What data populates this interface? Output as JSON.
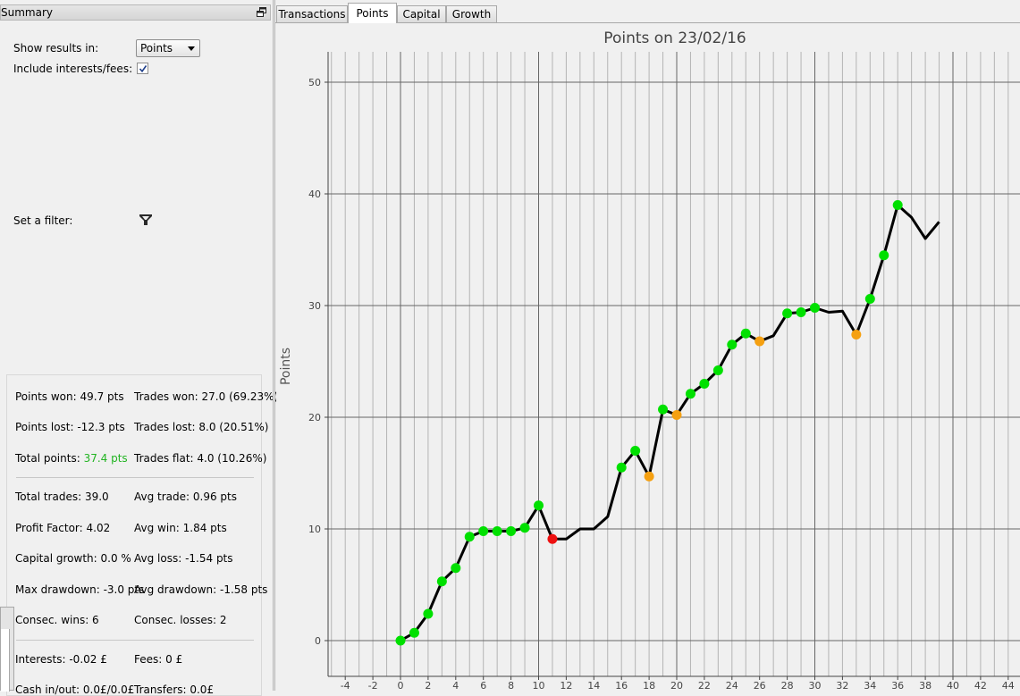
{
  "summary": {
    "title": "Summary",
    "show_results_label": "Show results in:",
    "show_results_value": "Points",
    "include_label": "Include interests/fees:",
    "include_checked": true,
    "filter_label": "Set a filter:"
  },
  "stats": {
    "points_won": "Points won: 49.7 pts",
    "trades_won": "Trades won: 27.0 (69.23%)",
    "points_lost": "Points lost: -12.3 pts",
    "trades_lost": "Trades lost: 8.0 (20.51%)",
    "total_points_label": "Total points:",
    "total_points_value": "37.4 pts",
    "trades_flat": "Trades flat: 4.0 (10.26%)",
    "total_trades": "Total trades: 39.0",
    "avg_trade": "Avg trade: 0.96 pts",
    "profit_factor": "Profit Factor: 4.02",
    "avg_win": "Avg win: 1.84 pts",
    "capital_growth": "Capital growth: 0.0 %",
    "avg_loss": "Avg loss: -1.54 pts",
    "max_drawdown": "Max drawdown: -3.0 pts",
    "avg_drawdown": "Avg drawdown: -1.58 pts",
    "consec_wins": "Consec. wins: 6",
    "consec_losses": "Consec. losses: 2",
    "interests": "Interests: -0.02 £",
    "fees": "Fees: 0 £",
    "cash_in_out": "Cash in/out: 0.0£/0.0£",
    "transfers": "Transfers: 0.0£"
  },
  "tabs": [
    {
      "label": "Transactions",
      "active": false
    },
    {
      "label": "Points",
      "active": true
    },
    {
      "label": "Capital",
      "active": false
    },
    {
      "label": "Growth",
      "active": false
    }
  ],
  "colors": {
    "win": "#00e000",
    "loss": "#ee1111",
    "flat": "#f5a011",
    "line": "#000000",
    "total_points_accent": "#22b422"
  },
  "icons": {
    "float": "float-window-icon",
    "filter": "funnel-icon",
    "checkbox": "checkmark-icon"
  },
  "chart_data": {
    "type": "line",
    "title": "Points on 23/02/16",
    "xlabel": "",
    "ylabel": "Points",
    "xlim": [
      -5,
      45
    ],
    "ylim": [
      -3,
      53
    ],
    "x_ticks": [
      -4,
      -2,
      0,
      2,
      4,
      6,
      8,
      10,
      12,
      14,
      16,
      18,
      20,
      22,
      24,
      26,
      28,
      30,
      32,
      34,
      36,
      38,
      40,
      42,
      44
    ],
    "y_ticks": [
      0,
      10,
      20,
      30,
      40,
      50
    ],
    "grid": true,
    "line": {
      "x": [
        0,
        1,
        2,
        3,
        4,
        5,
        6,
        7,
        8,
        9,
        10,
        11,
        12,
        13,
        14,
        15,
        16,
        17,
        18,
        19,
        20,
        21,
        22,
        23,
        24,
        25,
        26,
        27,
        28,
        29,
        30,
        31,
        32,
        33,
        34,
        35,
        36,
        37,
        38,
        39
      ],
      "y": [
        0,
        0.7,
        2.4,
        5.3,
        6.5,
        9.3,
        9.8,
        9.8,
        9.8,
        10.1,
        12.1,
        9.1,
        9.1,
        10.0,
        10.0,
        11.1,
        15.5,
        17.0,
        14.7,
        20.7,
        20.2,
        22.1,
        23.0,
        24.2,
        26.5,
        27.5,
        26.8,
        27.3,
        29.3,
        29.4,
        29.8,
        29.4,
        29.5,
        27.4,
        30.6,
        34.5,
        39.0,
        37.9,
        36.0,
        37.5
      ]
    },
    "points": [
      {
        "x": 0,
        "y": 0,
        "type": "win"
      },
      {
        "x": 1,
        "y": 0.7,
        "type": "win"
      },
      {
        "x": 2,
        "y": 2.4,
        "type": "win"
      },
      {
        "x": 3,
        "y": 5.3,
        "type": "win"
      },
      {
        "x": 4,
        "y": 6.5,
        "type": "win"
      },
      {
        "x": 5,
        "y": 9.3,
        "type": "win"
      },
      {
        "x": 6,
        "y": 9.8,
        "type": "win"
      },
      {
        "x": 7,
        "y": 9.8,
        "type": "win"
      },
      {
        "x": 8,
        "y": 9.8,
        "type": "win"
      },
      {
        "x": 9,
        "y": 10.1,
        "type": "win"
      },
      {
        "x": 10,
        "y": 12.1,
        "type": "win"
      },
      {
        "x": 11,
        "y": 9.1,
        "type": "loss"
      },
      {
        "x": 16,
        "y": 15.5,
        "type": "win"
      },
      {
        "x": 17,
        "y": 17.0,
        "type": "win"
      },
      {
        "x": 18,
        "y": 14.7,
        "type": "flat"
      },
      {
        "x": 19,
        "y": 20.7,
        "type": "win"
      },
      {
        "x": 20,
        "y": 20.2,
        "type": "flat"
      },
      {
        "x": 21,
        "y": 22.1,
        "type": "win"
      },
      {
        "x": 22,
        "y": 23.0,
        "type": "win"
      },
      {
        "x": 23,
        "y": 24.2,
        "type": "win"
      },
      {
        "x": 24,
        "y": 26.5,
        "type": "win"
      },
      {
        "x": 25,
        "y": 27.5,
        "type": "win"
      },
      {
        "x": 26,
        "y": 26.8,
        "type": "flat"
      },
      {
        "x": 28,
        "y": 29.3,
        "type": "win"
      },
      {
        "x": 29,
        "y": 29.4,
        "type": "win"
      },
      {
        "x": 30,
        "y": 29.8,
        "type": "win"
      },
      {
        "x": 33,
        "y": 27.4,
        "type": "flat"
      },
      {
        "x": 34,
        "y": 30.6,
        "type": "win"
      },
      {
        "x": 35,
        "y": 34.5,
        "type": "win"
      },
      {
        "x": 36,
        "y": 39.0,
        "type": "win"
      }
    ]
  }
}
